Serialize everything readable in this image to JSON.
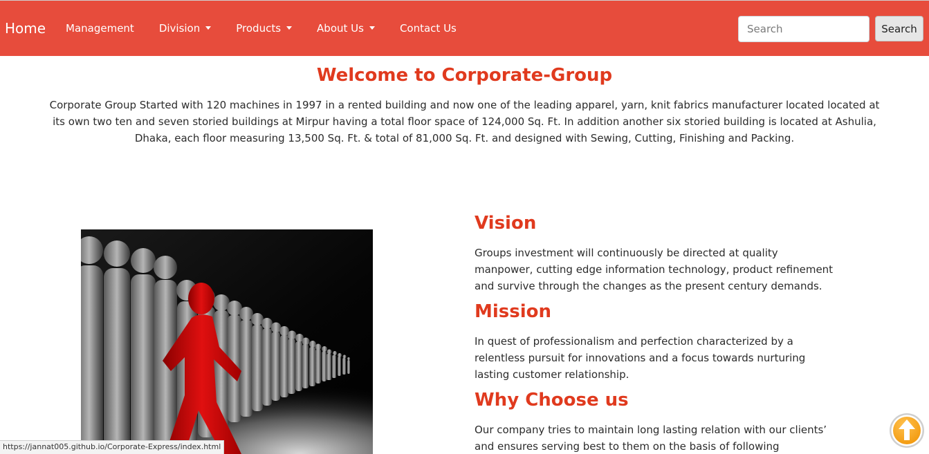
{
  "navbar": {
    "brand": "Home",
    "links": [
      {
        "label": "Management",
        "dropdown": false
      },
      {
        "label": "Division",
        "dropdown": true
      },
      {
        "label": "Products",
        "dropdown": true
      },
      {
        "label": "About Us",
        "dropdown": true
      },
      {
        "label": "Contact Us",
        "dropdown": false
      }
    ],
    "search_placeholder": "Search",
    "search_button": "Search"
  },
  "welcome": {
    "title": "Welcome to Corporate-Group",
    "text": "Corporate Group Started with 120 machines in 1997 in a rented building and now one of the leading apparel, yarn, knit fabrics manufacturer located located at its own two ten and seven storied buildings at Mirpur having a total floor space of 124,000 Sq. Ft. In addition another six storied building is located at Ashulia, Dhaka, each floor measuring 13,500 Sq. Ft. & total of 81,000 Sq. Ft. and designed with Sewing, Cutting, Finishing and Packing."
  },
  "vision": {
    "title": "Vision",
    "text": "Groups investment will continuously be directed at quality manpower, cutting edge information technology, product refinement and survive through the changes as the present century demands."
  },
  "mission": {
    "title": "Mission",
    "text": "In quest of professionalism and perfection characterized by a relentless pursuit for innovations and a focus towards nurturing lasting customer relationship."
  },
  "why": {
    "title": "Why Choose us",
    "text": "Our company tries to maintain long lasting relation with our clients’ and ensures serving best to them on the basis of following parameters:"
  },
  "status_url": "https://jannat005.github.io/Corporate-Express/index.html",
  "icons": {
    "hero": "leader-figure-image",
    "scroll": "arrow-up-icon",
    "caret": "caret-down-icon"
  },
  "colors": {
    "navbar": "#e74c3c",
    "heading": "#e03a1e",
    "scroll_button": "#f39c12"
  }
}
